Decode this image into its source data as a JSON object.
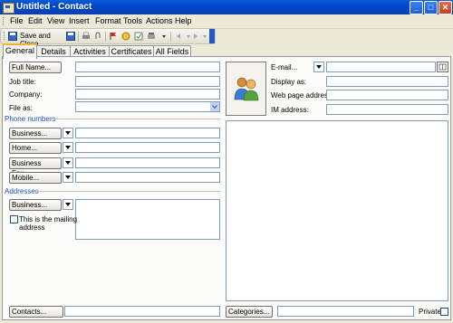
{
  "window": {
    "title": "Untitled - Contact",
    "min_glyph": "_",
    "max_glyph": "□",
    "close_glyph": "✕"
  },
  "menu": [
    "File",
    "Edit",
    "View",
    "Insert",
    "Format",
    "Tools",
    "Actions",
    "Help"
  ],
  "toolbar": {
    "save_close": "Save and Close"
  },
  "tabs": [
    "General",
    "Details",
    "Activities",
    "Certificates",
    "All Fields"
  ],
  "left": {
    "full_name": "Full Name...",
    "job_title": "Job title:",
    "company": "Company:",
    "file_as": "File as:",
    "phone_section": "Phone numbers",
    "phones": [
      "Business...",
      "Home...",
      "Business Fax...",
      "Mobile..."
    ],
    "address_section": "Addresses",
    "address_type": "Business...",
    "mailing_line1": "This is the mailing",
    "mailing_line2": "address"
  },
  "right": {
    "email": "E-mail...",
    "display_as": "Display as:",
    "web_page": "Web page address:",
    "im_address": "IM address:"
  },
  "bottom": {
    "contacts": "Contacts...",
    "categories": "Categories...",
    "private": "Private"
  },
  "colors": {
    "titlebar": "#0046c8",
    "section": "#1f4ec5",
    "active_tab_accent": "#f9b531"
  }
}
